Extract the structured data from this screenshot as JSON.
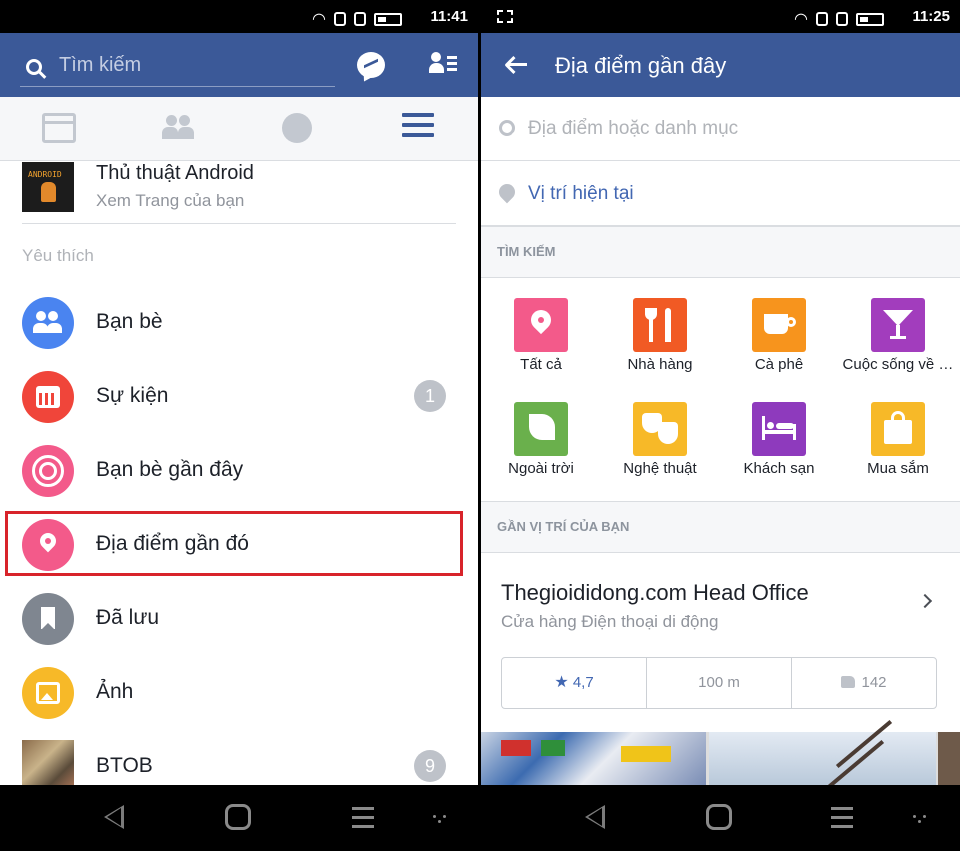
{
  "left": {
    "status_time": "11:41",
    "search_placeholder": "Tìm kiếm",
    "profile": {
      "name": "Thủ thuật Android",
      "subtitle": "Xem Trang của bạn",
      "thumb_text": "ANDROID"
    },
    "section_title": "Yêu thích",
    "menu": [
      {
        "label": "Bạn bè",
        "icon": "friends-icon",
        "color": "#4a84f0"
      },
      {
        "label": "Sự kiện",
        "icon": "calendar-icon",
        "color": "#f0453a",
        "badge": "1"
      },
      {
        "label": "Bạn bè gần đây",
        "icon": "nearby-friends-icon",
        "color": "#f35a8a"
      },
      {
        "label": "Địa điểm gần đó",
        "icon": "location-pin-icon",
        "color": "#f35a8a",
        "highlighted": true
      },
      {
        "label": "Đã lưu",
        "icon": "bookmark-icon",
        "color": "#7f8690"
      },
      {
        "label": "Ảnh",
        "icon": "photo-icon",
        "color": "#f7b928"
      },
      {
        "label": "BTOB",
        "icon": "group-avatar",
        "badge": "9"
      }
    ]
  },
  "right": {
    "status_time": "11:25",
    "title": "Địa điểm gần đây",
    "search_placeholder": "Địa điểm hoặc danh mục",
    "current_location": "Vị trí hiện tại",
    "search_section": "TÌM KIẾM",
    "categories": [
      {
        "label": "Tất cả",
        "icon": "location-pin-icon",
        "color": "#f35a8a"
      },
      {
        "label": "Nhà hàng",
        "icon": "fork-knife-icon",
        "color": "#f15a24"
      },
      {
        "label": "Cà phê",
        "icon": "coffee-cup-icon",
        "color": "#f7941d"
      },
      {
        "label": "Cuộc sống về …",
        "icon": "cocktail-icon",
        "color": "#a23dbd"
      },
      {
        "label": "Ngoài trời",
        "icon": "leaf-icon",
        "color": "#6ab04c"
      },
      {
        "label": "Nghệ thuật",
        "icon": "theater-masks-icon",
        "color": "#f7b928"
      },
      {
        "label": "Khách sạn",
        "icon": "bed-icon",
        "color": "#8e3abd"
      },
      {
        "label": "Mua sắm",
        "icon": "shopping-bag-icon",
        "color": "#f7b928"
      }
    ],
    "nearby_section": "GẦN VỊ TRÍ CỦA BẠN",
    "place": {
      "name": "Thegioididong.com Head Office",
      "category": "Cửa hàng Điện thoại di động",
      "rating": "4,7",
      "distance": "100 m",
      "likes": "142"
    }
  },
  "colors": {
    "facebook_blue": "#3b5998",
    "link_blue": "#4267b2",
    "highlight_red": "#d8232a"
  }
}
